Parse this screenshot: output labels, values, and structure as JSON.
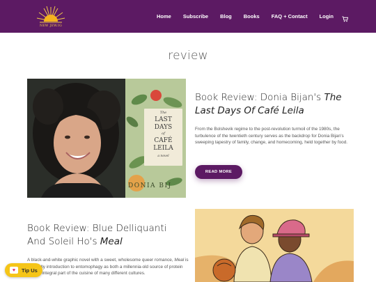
{
  "brand": {
    "logo_text": "NEW JEW.IG"
  },
  "nav": {
    "items": [
      "Home",
      "Subscribe",
      "Blog",
      "Books",
      "FAQ + Contact",
      "Login"
    ],
    "cart_icon": "cart-icon"
  },
  "page": {
    "title": "review"
  },
  "posts": [
    {
      "title_prefix": "Book Review: Donia Bijan's ",
      "title_italic": "The Last Days Of Café Leila",
      "excerpt": "From the Bolshevik regime to the post-revolution turmoil of the 1980s, the turbulence of the twentieth century serves as the backdrop for Donia Bijan's sweeping tapestry of family, change, and homecoming, held together by food.",
      "button": "READ MORE",
      "cover": {
        "line1": "The",
        "line2": "LAST",
        "line3": "DAYS",
        "line4": "of",
        "line5": "CAFÉ",
        "line6": "LEILA",
        "line7": "a novel",
        "author": "DONIA BIJ"
      }
    },
    {
      "title_prefix": "Book Review: Blue Delliquanti And Soleil Ho's ",
      "title_italic": "Meal",
      "excerpt_start": "A black-and-white graphic novel with a sweet, wholesome queer",
      "excerpt_mid_prefix": "romance, ",
      "excerpt_mid_italic": "Meal",
      "excerpt_mid_suffix": " is a friendly introduction to entomophagy as both a",
      "excerpt_end": "millennia-old source of protein and an integral part of the cuisine of many different cultures."
    }
  ],
  "tip": {
    "label": "Tip Us"
  },
  "colors": {
    "brand_purple": "#5c1a63",
    "tip_yellow": "#f5c518"
  }
}
